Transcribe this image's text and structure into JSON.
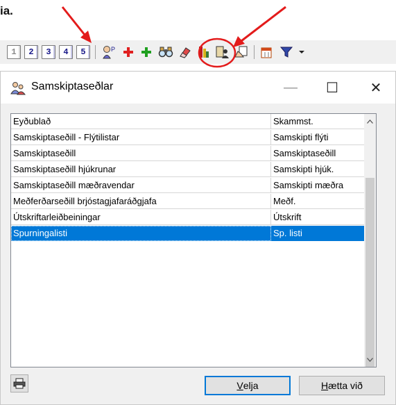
{
  "fragment_text": "ia.",
  "toolbar": {
    "number_buttons": [
      "1",
      "2",
      "3",
      "4",
      "5"
    ],
    "icons": [
      "patient-icon",
      "red-plus-icon",
      "green-plus-icon",
      "binoculars-icon",
      "eraser-icon",
      "bookmark-chart-icon",
      "document-person-icon",
      "hand-document-icon",
      "calendar-filter-icon",
      "filter-funnel-icon",
      "dropdown-arrow-icon"
    ]
  },
  "dialog": {
    "title": "Samskiptaseðlar",
    "minimize": "—",
    "maximize": "☐",
    "close": "✕",
    "columns": {
      "name": "Eyðublað",
      "abbr": "Skammst."
    },
    "rows": [
      {
        "name": "Samskiptaseðill - Flýtilistar",
        "abbr": "Samskipti flýti"
      },
      {
        "name": "Samskiptaseðill",
        "abbr": "Samskiptaseðill"
      },
      {
        "name": "Samskiptaseðill hjúkrunar",
        "abbr": "Samskipti hjúk."
      },
      {
        "name": "Samskiptaseðill mæðravendar",
        "abbr": "Samskipti mæðra"
      },
      {
        "name": "Meðferðarseðill brjóstagjafaráðgjafa",
        "abbr": "Meðf."
      },
      {
        "name": "Útskriftarleiðbeiningar",
        "abbr": "Útskrift"
      },
      {
        "name": "Spurningalisti",
        "abbr": "Sp. listi"
      }
    ],
    "selected_row": "Spurningalisti",
    "buttons": {
      "select_prefix": "V",
      "select_rest": "elja",
      "cancel_prefix": "H",
      "cancel_rest": "ætta við"
    }
  },
  "colors": {
    "selection": "#0078d7",
    "annotation": "#e31b1b"
  }
}
